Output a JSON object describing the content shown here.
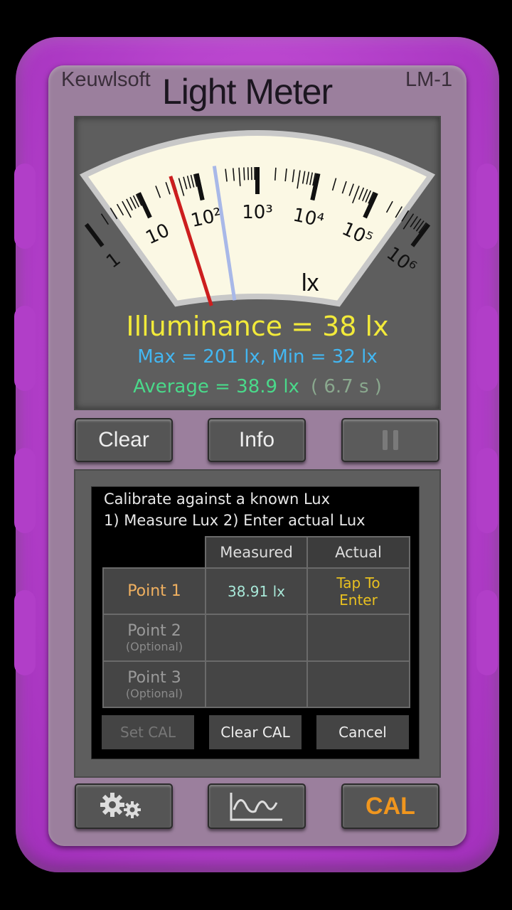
{
  "header": {
    "brand": "Keuwlsoft",
    "title": "Light Meter",
    "model": "LM-1"
  },
  "meter": {
    "scale_labels": [
      "1",
      "10",
      "10²",
      "10³",
      "10⁴",
      "10⁵",
      "10⁶"
    ],
    "unit": "lx",
    "needle_value_lx": 38,
    "max_marker_lx": 201,
    "colors": {
      "needle": "#cc1e1e",
      "max_marker": "#a8b8e8"
    }
  },
  "readout": {
    "illuminance": "Illuminance = 38 lx",
    "maxmin": "Max = 201 lx,  Min = 32 lx",
    "average": "Average = 38.9 lx",
    "time": "( 6.7 s )"
  },
  "controls": {
    "clear": "Clear",
    "info": "Info"
  },
  "calibration": {
    "line1": "Calibrate against a known Lux",
    "line2": "1) Measure Lux  2) Enter actual Lux",
    "headers": {
      "measured": "Measured",
      "actual": "Actual"
    },
    "rows": [
      {
        "label": "Point 1",
        "sub": "",
        "measured": "38.91 lx",
        "actual_line1": "Tap To",
        "actual_line2": "Enter"
      },
      {
        "label": "Point 2",
        "sub": "(Optional)",
        "measured": "",
        "actual_line1": "",
        "actual_line2": ""
      },
      {
        "label": "Point 3",
        "sub": "(Optional)",
        "measured": "",
        "actual_line1": "",
        "actual_line2": ""
      }
    ],
    "buttons": {
      "set": "Set CAL",
      "clear": "Clear CAL",
      "cancel": "Cancel"
    }
  },
  "bottom": {
    "settings_icon": "gears-icon",
    "graph_icon": "graph-icon",
    "cal": "CAL"
  },
  "colors": {
    "casing": "#b13ec8",
    "face": "#9b7f9d",
    "illuminance": "#f2ea3a",
    "maxmin": "#43b7f2",
    "average": "#4ad98a",
    "cal_accent": "#f0961e"
  }
}
